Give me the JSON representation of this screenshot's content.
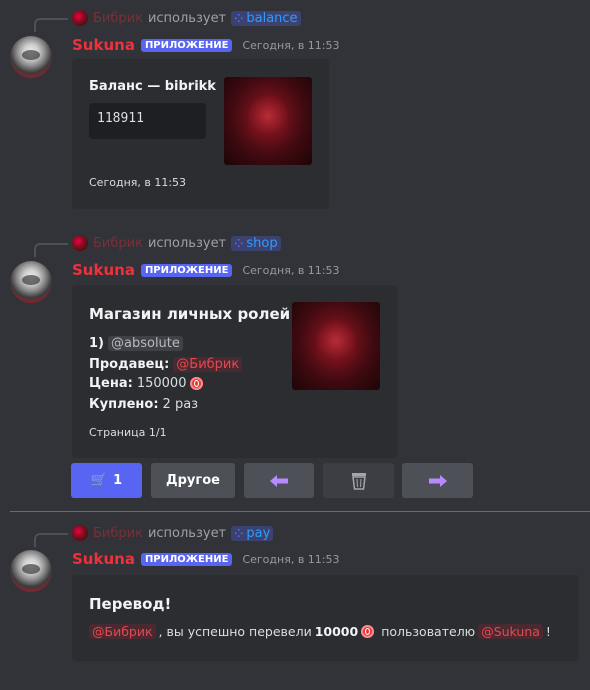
{
  "messages": [
    {
      "reply": {
        "user": "Бибрик",
        "uses": "использует",
        "command": "balance"
      },
      "author": "Sukuna",
      "app_tag": "ПРИЛОЖЕНИЕ",
      "time": "Сегодня, в 11:53",
      "embed": {
        "title": "Баланс — bibrikk",
        "balance": "118911",
        "footer": "Сегодня, в 11:53"
      }
    },
    {
      "reply": {
        "user": "Бибрик",
        "uses": "использует",
        "command": "shop"
      },
      "author": "Sukuna",
      "app_tag": "ПРИЛОЖЕНИЕ",
      "time": "Сегодня, в 11:53",
      "embed": {
        "title": "Магазин личных ролей",
        "item_number": "1)",
        "role": "@absolute",
        "seller_label": "Продавец:",
        "seller": "@Бибрик",
        "price_label": "Цена:",
        "price": "150000",
        "bought_label": "Куплено:",
        "bought": "2 раз",
        "footer": "Страница 1/1"
      },
      "buttons": {
        "buy_count": "1",
        "other": "Другое",
        "cart_icon": "cart-icon",
        "prev_icon": "arrow-left-icon",
        "trash_icon": "trash-icon",
        "next_icon": "arrow-right-icon"
      }
    },
    {
      "reply": {
        "user": "Бибрик",
        "uses": "использует",
        "command": "pay"
      },
      "author": "Sukuna",
      "app_tag": "ПРИЛОЖЕНИЕ",
      "time": "Сегодня, в 11:53",
      "embed": {
        "title": "Перевод!",
        "from": "@Бибрик",
        "text1": ", вы успешно перевели",
        "amount": "10000",
        "text2": "пользователю",
        "to": "@Sukuna",
        "text3": "!"
      }
    }
  ],
  "colors": {
    "accent": "#5865f2",
    "author": "#f0303c",
    "divider": "#d83c3e"
  }
}
